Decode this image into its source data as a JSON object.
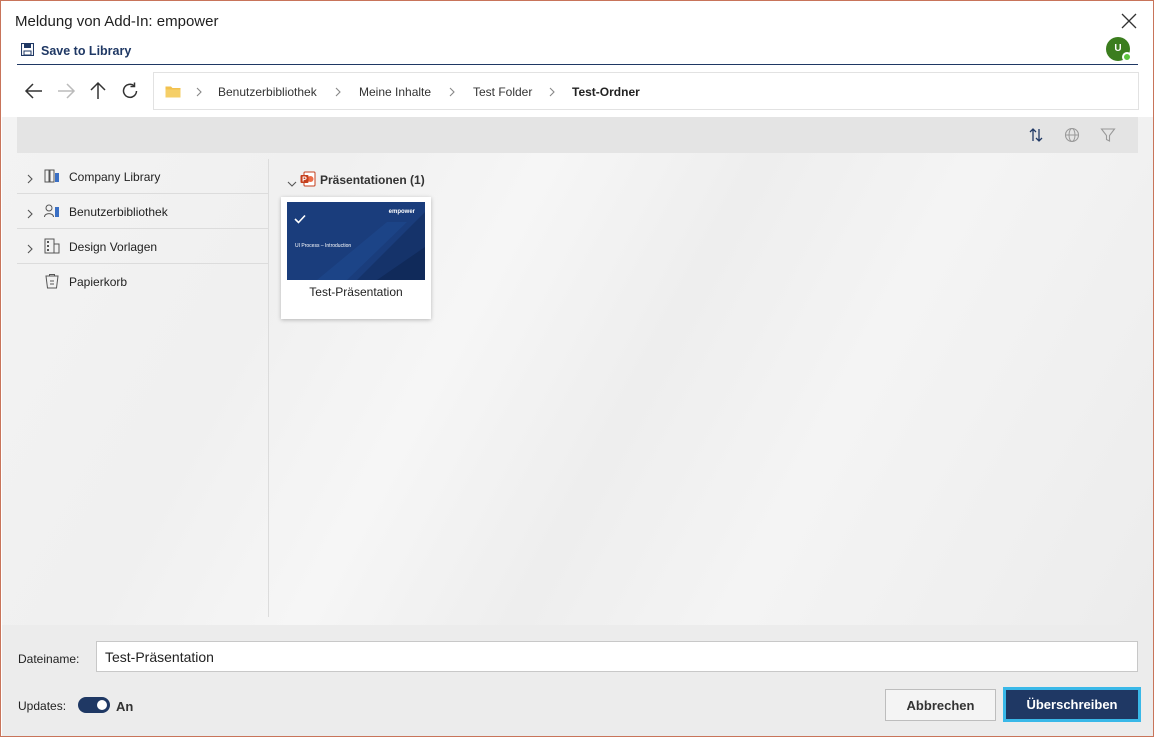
{
  "window": {
    "title": "Meldung von Add-In: empower",
    "close_icon": "close-icon"
  },
  "ribbon": {
    "save_label": "Save to Library",
    "user_initial": "U"
  },
  "navigation": {
    "back_icon": "arrow-left-icon",
    "forward_icon": "arrow-right-icon",
    "up_icon": "arrow-up-icon",
    "refresh_icon": "refresh-icon",
    "breadcrumb": [
      "Benutzerbibliothek",
      "Meine Inhalte",
      "Test Folder",
      "Test-Ordner"
    ]
  },
  "toolbar": {
    "icons": [
      "sort-icon",
      "globe-icon",
      "filter-icon"
    ]
  },
  "tree": {
    "items": [
      {
        "label": "Company Library",
        "expandable": true,
        "icon": "company-library-icon"
      },
      {
        "label": "Benutzerbibliothek",
        "expandable": true,
        "icon": "user-library-icon"
      },
      {
        "label": "Design Vorlagen",
        "expandable": true,
        "icon": "design-templates-icon"
      },
      {
        "label": "Papierkorb",
        "expandable": false,
        "icon": "trash-icon"
      }
    ]
  },
  "group": {
    "label": "Präsentationen (1)"
  },
  "card": {
    "name": "Test-Präsentation",
    "thumb_brand": "empower",
    "thumb_title": "UI Process – Introduction",
    "selected": true
  },
  "footer": {
    "filename_label": "Dateiname:",
    "filename_value": "Test-Präsentation",
    "updates_label": "Updates:",
    "updates_state": "An",
    "updates_on": true,
    "cancel_label": "Abbrechen",
    "overwrite_label": "Überschreiben"
  },
  "colors": {
    "accent": "#1f3864",
    "focus_ring": "#39b8e8",
    "avatar": "#3b7d1e",
    "thumbnail_bg": "#1a3d7c"
  }
}
